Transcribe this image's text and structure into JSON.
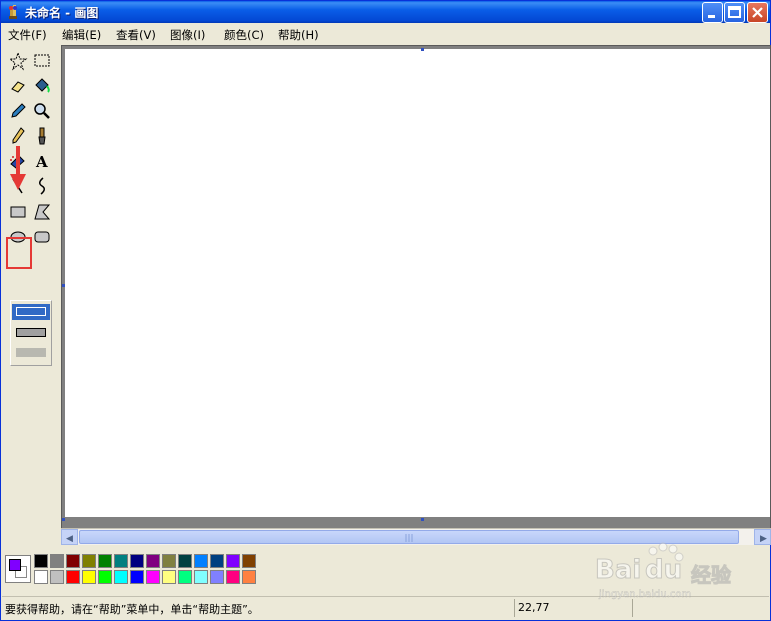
{
  "window": {
    "title": "未命名 - 画图"
  },
  "menu": [
    {
      "label": "文件(F)",
      "name": "menu-file"
    },
    {
      "label": "编辑(E)",
      "name": "menu-edit"
    },
    {
      "label": "查看(V)",
      "name": "menu-view"
    },
    {
      "label": "图像(I)",
      "name": "menu-image"
    },
    {
      "label": "颜色(C)",
      "name": "menu-colors"
    },
    {
      "label": "帮助(H)",
      "name": "menu-help"
    }
  ],
  "tools": [
    "free-select-icon",
    "rect-select-icon",
    "eraser-icon",
    "fill-bucket-icon",
    "color-picker-icon",
    "magnifier-icon",
    "pencil-icon",
    "brush-icon",
    "airbrush-icon",
    "text-tool-icon",
    "line-tool-icon",
    "curve-tool-icon",
    "rectangle-tool-icon",
    "polygon-tool-icon",
    "ellipse-tool-icon",
    "rounded-rect-tool-icon"
  ],
  "colors": {
    "foreground": "#8000ff",
    "background": "#ffffff",
    "palette_top": [
      "#000000",
      "#808080",
      "#800000",
      "#808000",
      "#008000",
      "#008080",
      "#000080",
      "#800080",
      "#808040",
      "#004040",
      "#0080ff",
      "#004080",
      "#8000ff",
      "#804000"
    ],
    "palette_bottom": [
      "#ffffff",
      "#c0c0c0",
      "#ff0000",
      "#ffff00",
      "#00ff00",
      "#00ffff",
      "#0000ff",
      "#ff00ff",
      "#ffff80",
      "#00ff80",
      "#80ffff",
      "#8080ff",
      "#ff0080",
      "#ff8040"
    ]
  },
  "status": {
    "text": "要获得帮助，请在“帮助”菜单中，单击“帮助主题”。",
    "coords": "22,77"
  },
  "watermark": {
    "brand": "Bai",
    "brand_suffix": "经验",
    "url": "jingyan.baidu.com"
  }
}
